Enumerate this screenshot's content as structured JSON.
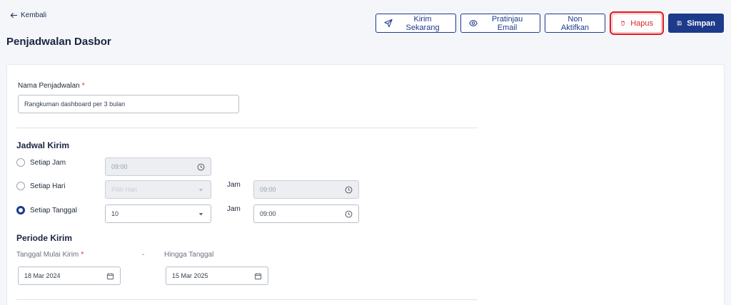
{
  "header": {
    "back_label": "Kembali",
    "title": "Penjadwalan Dasbor"
  },
  "toolbar": {
    "send_now": "Kirim Sekarang",
    "preview_email": "Pratinjau Email",
    "deactivate": "Non Aktifkan",
    "delete": "Hapus",
    "save": "Simpan"
  },
  "form": {
    "name_label": "Nama Penjadwalan",
    "required_mark": "*",
    "name_value": "Rangkuman dashboard per 3 bulan",
    "schedule_title": "Jadwal Kirim",
    "options": [
      {
        "label": "Setiap Jam",
        "selected": false
      },
      {
        "label": "Setiap Hari",
        "selected": false
      },
      {
        "label": "Setiap Tanggal",
        "selected": true
      }
    ],
    "hourly_time": "09:00",
    "daily_day_placeholder": "Pilih Hari",
    "jam_label": "Jam",
    "daily_time": "09:00",
    "date_value": "10",
    "date_time": "09:00",
    "period_title": "Periode Kirim",
    "start_label": "Tanggal Mulai Kirim",
    "separator": "-",
    "end_label": "Hingga Tanggal",
    "start_value": "18 Mar 2024",
    "end_value": "15 Mar 2025"
  },
  "colors": {
    "primary": "#1e3a8a",
    "danger": "#dc2626",
    "highlight": "#e0191f"
  }
}
